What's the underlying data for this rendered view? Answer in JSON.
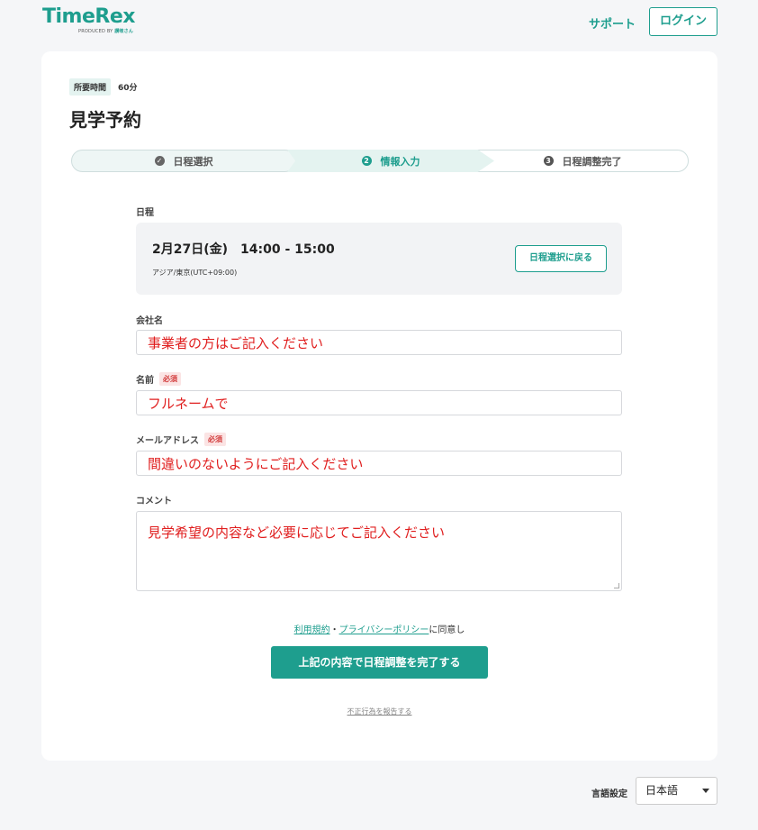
{
  "header": {
    "logo_text": "TimeRex",
    "logo_sub": "PRODUCED BY",
    "logo_sub_brand": "讃岐さん",
    "support_label": "サポート",
    "login_label": "ログイン"
  },
  "event": {
    "duration_tag": "所要時間",
    "duration_value": "60分",
    "title": "見学予約"
  },
  "stepper": {
    "steps": [
      {
        "num": "✓",
        "label": "日程選択"
      },
      {
        "num": "2",
        "label": "情報入力"
      },
      {
        "num": "3",
        "label": "日程調整完了"
      }
    ]
  },
  "schedule": {
    "label": "日程",
    "date": "2月27日(金)　14:00 - 15:00",
    "timezone": "アジア/東京(UTC+09:00)",
    "back_label": "日程選択に戻る"
  },
  "form": {
    "company_label": "会社名",
    "company_value": "事業者の方はご記入ください",
    "name_label": "名前",
    "name_value": "フルネームで",
    "email_label": "メールアドレス",
    "email_value": "間違いのないようにご記入ください",
    "comment_label": "コメント",
    "comment_value": "見学希望の内容など必要に応じてご記入ください",
    "required_badge": "必須"
  },
  "agreement": {
    "terms_link": "利用規約",
    "separator": "・",
    "privacy_link": "プライバシーポリシー",
    "suffix": "に同意し"
  },
  "submit_label": "上記の内容で日程調整を完了する",
  "report_label": "不正行為を報告する",
  "language": {
    "label": "言語設定",
    "selected": "日本語"
  },
  "colors": {
    "accent": "#1e9e8e",
    "placeholder_text": "#e01e1e",
    "required_bg": "#fbe4e4"
  }
}
